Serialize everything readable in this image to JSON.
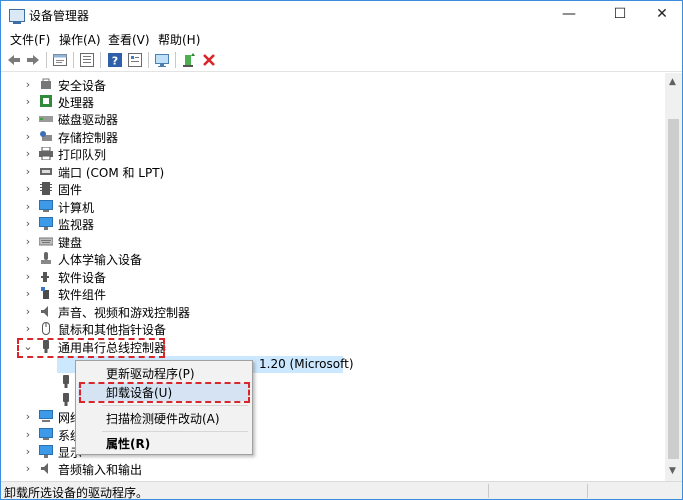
{
  "window": {
    "title": "设备管理器",
    "controls": {
      "minimize": "—",
      "maximize": "☐",
      "close": "✕"
    }
  },
  "menu": [
    "文件(F)",
    "操作(A)",
    "查看(V)",
    "帮助(H)"
  ],
  "toolbar": {
    "icons": [
      "back-icon",
      "forward-icon",
      "properties-icon",
      "list-icon",
      "help-icon",
      "monitor-icon",
      "update-driver-icon",
      "uninstall-x-icon"
    ],
    "accent": "#d9262b"
  },
  "tree": {
    "items": [
      {
        "label": "安全设备",
        "icon": "security-device-icon"
      },
      {
        "label": "处理器",
        "icon": "processor-icon"
      },
      {
        "label": "磁盘驱动器",
        "icon": "disk-drive-icon"
      },
      {
        "label": "存储控制器",
        "icon": "storage-controller-icon"
      },
      {
        "label": "打印队列",
        "icon": "printer-icon"
      },
      {
        "label": "端口 (COM 和 LPT)",
        "icon": "port-icon"
      },
      {
        "label": "固件",
        "icon": "firmware-icon"
      },
      {
        "label": "计算机",
        "icon": "computer-icon"
      },
      {
        "label": "监视器",
        "icon": "monitor-icon"
      },
      {
        "label": "键盘",
        "icon": "keyboard-icon"
      },
      {
        "label": "人体学输入设备",
        "icon": "hid-icon"
      },
      {
        "label": "软件设备",
        "icon": "software-device-icon"
      },
      {
        "label": "软件组件",
        "icon": "software-component-icon"
      },
      {
        "label": "声音、视频和游戏控制器",
        "icon": "audio-icon"
      },
      {
        "label": "鼠标和其他指针设备",
        "icon": "mouse-icon"
      },
      {
        "label": "通用串行总线控制器",
        "icon": "usb-icon"
      }
    ],
    "selected_suffix": "1.20 (Microsoft)",
    "bottom_items": [
      {
        "label": "网络",
        "icon": "network-icon"
      },
      {
        "label": "系统",
        "icon": "system-icon"
      },
      {
        "label": "显示",
        "icon": "display-icon"
      },
      {
        "label": "音频输入和输出",
        "icon": "audio-io-icon"
      }
    ]
  },
  "context_menu": {
    "update_driver": "更新驱动程序(P)",
    "uninstall": "卸载设备(U)",
    "scan": "扫描检测硬件改动(A)",
    "properties": "属性(R)"
  },
  "status": "卸载所选设备的驱动程序。"
}
